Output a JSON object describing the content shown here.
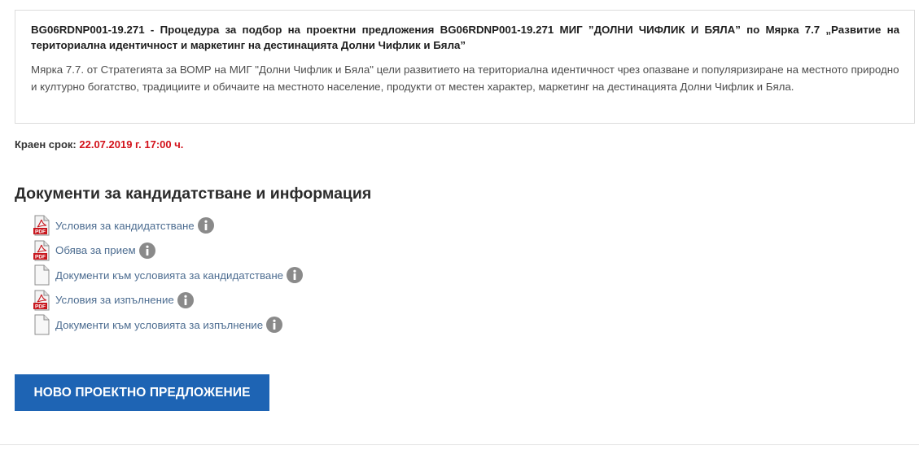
{
  "procedure": {
    "title": "BG06RDNP001-19.271 - Процедура за подбор на проектни предложения BG06RDNP001-19.271 МИГ ”ДОЛНИ ЧИФЛИК И БЯЛА” по Мярка 7.7 „Развитие на териториална идентичност и маркетинг на дестинацията Долни Чифлик и Бяла”",
    "description": "Мярка 7.7. от Стратегията за ВОМР на МИГ \"Долни Чифлик и Бяла\" цели развитието на териториална идентичност чрез опазване и популяризиране на местното природно и културно богатство, традициите и обичаите на местното население, продукти от местен характер, маркетинг на дестинацията Долни Чифлик и Бяла."
  },
  "deadline": {
    "label": "Краен срок:",
    "value": "22.07.2019 г. 17:00 ч."
  },
  "documents": {
    "heading": "Документи за кандидатстване и информация",
    "items": [
      {
        "label": "Условия за кандидатстване",
        "icon": "pdf-file-icon"
      },
      {
        "label": "Обява за прием",
        "icon": "pdf-file-icon"
      },
      {
        "label": "Документи към условията за кандидатстване",
        "icon": "document-file-icon"
      },
      {
        "label": "Условия за изпълнение",
        "icon": "pdf-file-icon"
      },
      {
        "label": "Документи към условията за изпълнение",
        "icon": "document-file-icon"
      }
    ]
  },
  "actions": {
    "new_proposal_label": "НОВО ПРОЕКТНО ПРЕДЛОЖЕНИЕ"
  },
  "colors": {
    "deadline_value": "#d3121b",
    "link": "#4d6d91",
    "button": "#1e64b4",
    "info_icon": "#8a8a8a",
    "pdf_badge": "#c8171e"
  }
}
